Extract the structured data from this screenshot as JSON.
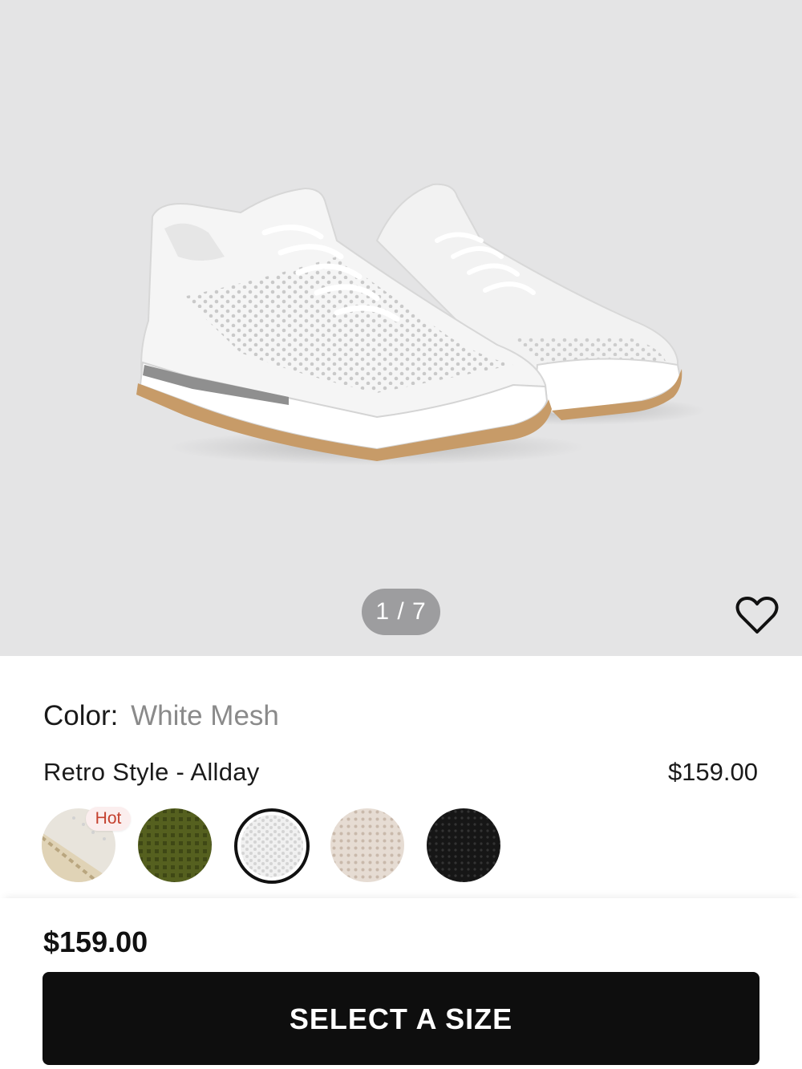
{
  "gallery": {
    "image": "white-mesh-retro-sneakers",
    "pager": "1 / 7"
  },
  "wishlist": {
    "icon": "heart-icon"
  },
  "details": {
    "color_label": "Color:",
    "color_value": "White Mesh",
    "name": "Retro Style - Allday",
    "price": "$159.00"
  },
  "swatches": {
    "badge": "Hot",
    "items": [
      {
        "name": "cream-leather",
        "color": "#e3d8c4"
      },
      {
        "name": "olive-mesh",
        "color": "#4f5a22"
      },
      {
        "name": "white-mesh",
        "color": "#eeeeee",
        "selected": true
      },
      {
        "name": "beige-mesh",
        "color": "#e2d6cc"
      },
      {
        "name": "black-mesh",
        "color": "#1a1a1a"
      }
    ]
  },
  "bottom_bar": {
    "price": "$159.00",
    "cta_label": "SELECT A SIZE"
  }
}
